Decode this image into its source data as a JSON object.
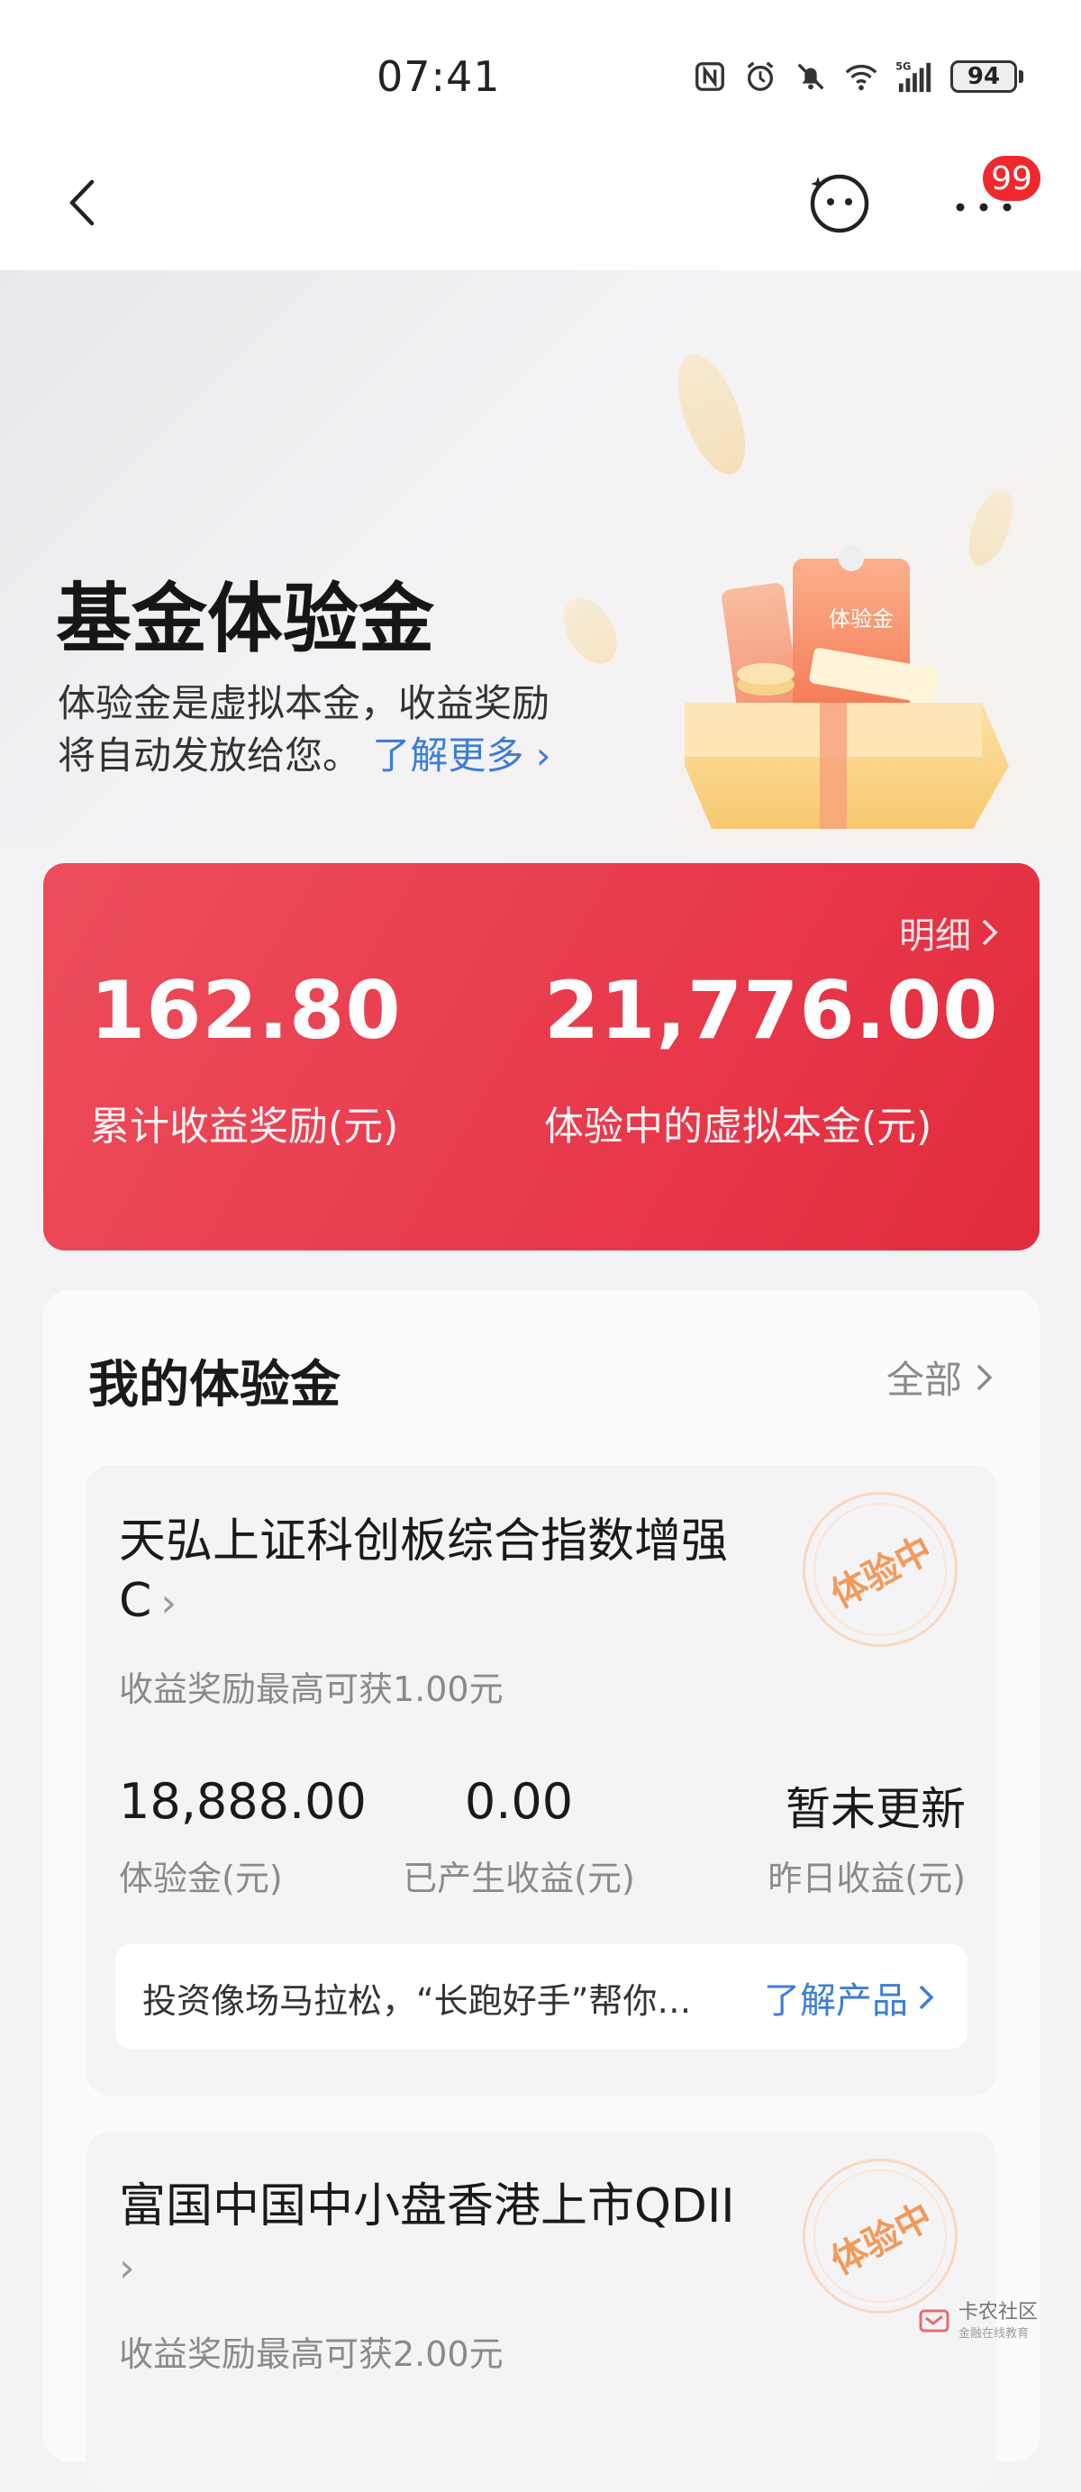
{
  "status_bar": {
    "time": "07:41",
    "battery": "94",
    "icons": [
      "nfc-icon",
      "alarm-icon",
      "mute-icon",
      "wifi-icon",
      "signal-5g-icon",
      "battery-icon"
    ]
  },
  "nav": {
    "back_icon": "chevron-left-icon",
    "assistant_icon": "bot-face-icon",
    "more_icon": "more-dots-icon",
    "badge_count": "99"
  },
  "hero": {
    "title": "基金体验金",
    "desc_line1": "体验金是虚拟本金，收益奖励",
    "desc_line2": "将自动发放给您。",
    "learn_more": "了解更多",
    "illustration_label": "体验金"
  },
  "summary": {
    "detail_label": "明细",
    "total_reward_value": "162.80",
    "total_reward_label": "累计收益奖励(元)",
    "virtual_principal_value": "21,776.00",
    "virtual_principal_label": "体验中的虚拟本金(元)"
  },
  "my_funds": {
    "title": "我的体验金",
    "all_label": "全部",
    "items": [
      {
        "name_line1": "天弘上证科创板综合指数增强",
        "name_line2": "C",
        "reward_note": "收益奖励最高可获1.00元",
        "stamp": "体验中",
        "amount_value": "18,888.00",
        "amount_label": "体验金(元)",
        "earned_value": "0.00",
        "earned_label": "已产生收益(元)",
        "yesterday_value": "暂未更新",
        "yesterday_label": "昨日收益(元)",
        "promo_text": "投资像场马拉松，“长跑好手”帮你…",
        "promo_link": "了解产品"
      },
      {
        "name_line1": "富国中国中小盘香港上市QDII",
        "reward_note": "收益奖励最高可获2.00元",
        "stamp": "体验中"
      }
    ]
  },
  "watermark": {
    "text": "卡农社区",
    "sub": "金融在线教育"
  },
  "colors": {
    "accent_red": "#e8394b",
    "link_blue": "#3d7ed6",
    "stamp_orange": "#f29a5a",
    "badge_red": "#f0282d"
  }
}
